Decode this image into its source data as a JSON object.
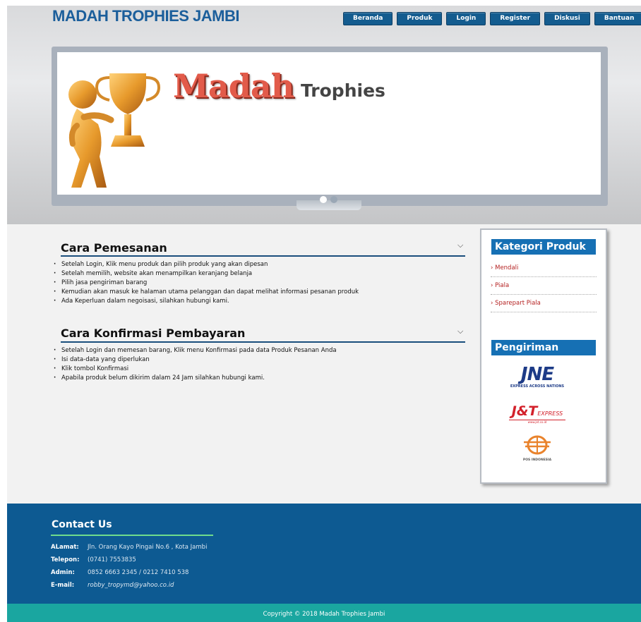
{
  "header": {
    "site_title": "MADAH TROPHIES JAMBI",
    "nav": [
      "Beranda",
      "Produk",
      "Login",
      "Register",
      "Diskusi",
      "Bantuan"
    ]
  },
  "banner": {
    "brand_word_1": "Madah",
    "brand_word_2": "Trophies"
  },
  "sections": [
    {
      "title": "Cara Pemesanan",
      "items": [
        "Setelah Login, Klik menu produk dan pilih produk yang akan dipesan",
        "Setelah memilih, website akan menampilkan keranjang belanja",
        "Pilih jasa pengiriman barang",
        "Kemudian akan masuk ke halaman utama pelanggan dan dapat melihat informasi pesanan produk",
        "Ada Keperluan dalam negoisasi, silahkan hubungi kami."
      ]
    },
    {
      "title": "Cara Konfirmasi Pembayaran",
      "items": [
        "Setelah Login dan memesan barang, Klik menu Konfirmasi pada data Produk Pesanan Anda",
        "Isi data-data yang diperlukan",
        "Klik tombol Konfirmasi",
        "Apabila produk belum dikirim dalam 24 Jam silahkan hubungi kami."
      ]
    }
  ],
  "sidebar": {
    "category_title": "Kategori Produk",
    "categories": [
      "Mendali",
      "Piala",
      "Sparepart Piala"
    ],
    "shipping_title": "Pengiriman",
    "jne": {
      "name": "JNE",
      "tagline": "EXPRESS ACROSS NATIONS"
    },
    "jnt": {
      "name": "J&T",
      "suffix": "EXPRESS",
      "url": "www.jet.co.id"
    },
    "pos": {
      "name": "POS INDONESIA"
    }
  },
  "footer": {
    "contact_title": "Contact Us",
    "rows": [
      {
        "label": "ALamat:",
        "value": "Jln. Orang Kayo Pingai No.6 , Kota Jambi"
      },
      {
        "label": "Telepon:",
        "value": "(0741) 7553835"
      },
      {
        "label": "Admin:",
        "value": "0852 6663 2345 / 0212 7410 538"
      },
      {
        "label": "E-mail:",
        "value": "robby_tropymd@yahoo.co.id"
      }
    ],
    "copyright": "Copyright © 2018 Madah Trophies Jambi"
  },
  "colors": {
    "title_blue": "#1b5e9b",
    "nav_blue": "#145c8f",
    "footer_blue": "#0d5a92",
    "copyright_teal": "#1aa6a0",
    "category_red": "#b52222"
  }
}
